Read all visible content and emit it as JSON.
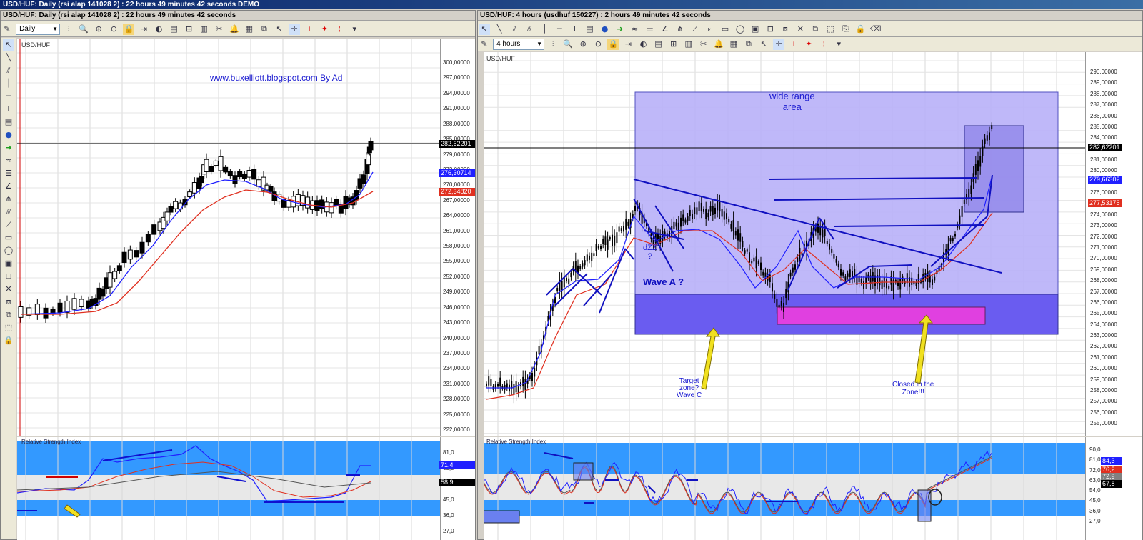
{
  "window": {
    "title": "USD/HUF: Daily (rsi alap 141028 2) : 22 hours 49 minutes 42 seconds DEMO"
  },
  "left": {
    "title": "USD/HUF: Daily (rsi alap 141028 2) : 22 hours 49 minutes 42 seconds",
    "timeframe": "Daily",
    "symbol": "USD/HUF",
    "watermark": "www.buxelliott.blogspot.com By Ad",
    "price_axis": [
      "300,00000",
      "297,00000",
      "294,00000",
      "291,00000",
      "288,00000",
      "285,00000",
      "279,00000",
      "273,00000",
      "270,00000",
      "267,00000",
      "264,00000",
      "261,00000",
      "258,00000",
      "255,00000",
      "252,00000",
      "249,00000",
      "246,00000",
      "243,00000",
      "240,00000",
      "237,00000",
      "234,00000",
      "231,00000",
      "228,00000",
      "225,00000",
      "222,00000"
    ],
    "tags": {
      "price": "282,62201",
      "blue": "276,30714",
      "red": "272,34820"
    },
    "rsi_label": "Relative Strength Index",
    "rsi_axis": [
      "81,0",
      "63,0",
      "54,0",
      "45,0",
      "36,0",
      "27,0"
    ],
    "rsi_tags": {
      "blue": "71,4",
      "black": "58,9"
    },
    "colors": {
      "blue_ma": "#2020ff",
      "red_ma": "#e03020",
      "price_line": "#000000",
      "rsi_band": "#3399ff"
    }
  },
  "right": {
    "title": "USD/HUF: 4 hours (usdhuf 150227) : 2 hours 49 minutes 42 seconds",
    "timeframe": "4 hours",
    "symbol": "USD/HUF",
    "annotations": {
      "wide_range": "wide range\narea",
      "dzz": "dZZ\n?",
      "wave_a": "Wave A ?",
      "target": "Target\nzone?\nWave C",
      "closed": "Closed in the\nZone!!!"
    },
    "price_axis": [
      "290,00000",
      "289,00000",
      "288,00000",
      "287,00000",
      "286,00000",
      "285,00000",
      "284,00000",
      "283,00000",
      "281,00000",
      "280,00000",
      "278,00000",
      "276,00000",
      "275,00000",
      "274,00000",
      "273,00000",
      "272,00000",
      "271,00000",
      "270,00000",
      "269,00000",
      "268,00000",
      "267,00000",
      "266,00000",
      "265,00000",
      "264,00000",
      "263,00000",
      "262,00000",
      "261,00000",
      "260,00000",
      "259,00000",
      "258,00000",
      "257,00000",
      "256,00000",
      "255,00000"
    ],
    "tags": {
      "price": "282,62201",
      "blue": "279,66302",
      "red": "277,53175"
    },
    "rsi_label": "Relative Strength Index",
    "rsi_axis": [
      "90,0",
      "81,0",
      "72,0",
      "63,0",
      "54,0",
      "45,0",
      "36,0",
      "27,0"
    ],
    "rsi_tags": {
      "blue": "84,3",
      "red": "76,2",
      "gray": "72,9",
      "black": "67,8"
    },
    "colors": {
      "zone_light": "#b8b0f8",
      "zone_dark": "#6a5cf0",
      "zone_magenta": "#e040e0",
      "blue_ma": "#2020ff",
      "red_ma": "#e03020"
    }
  }
}
